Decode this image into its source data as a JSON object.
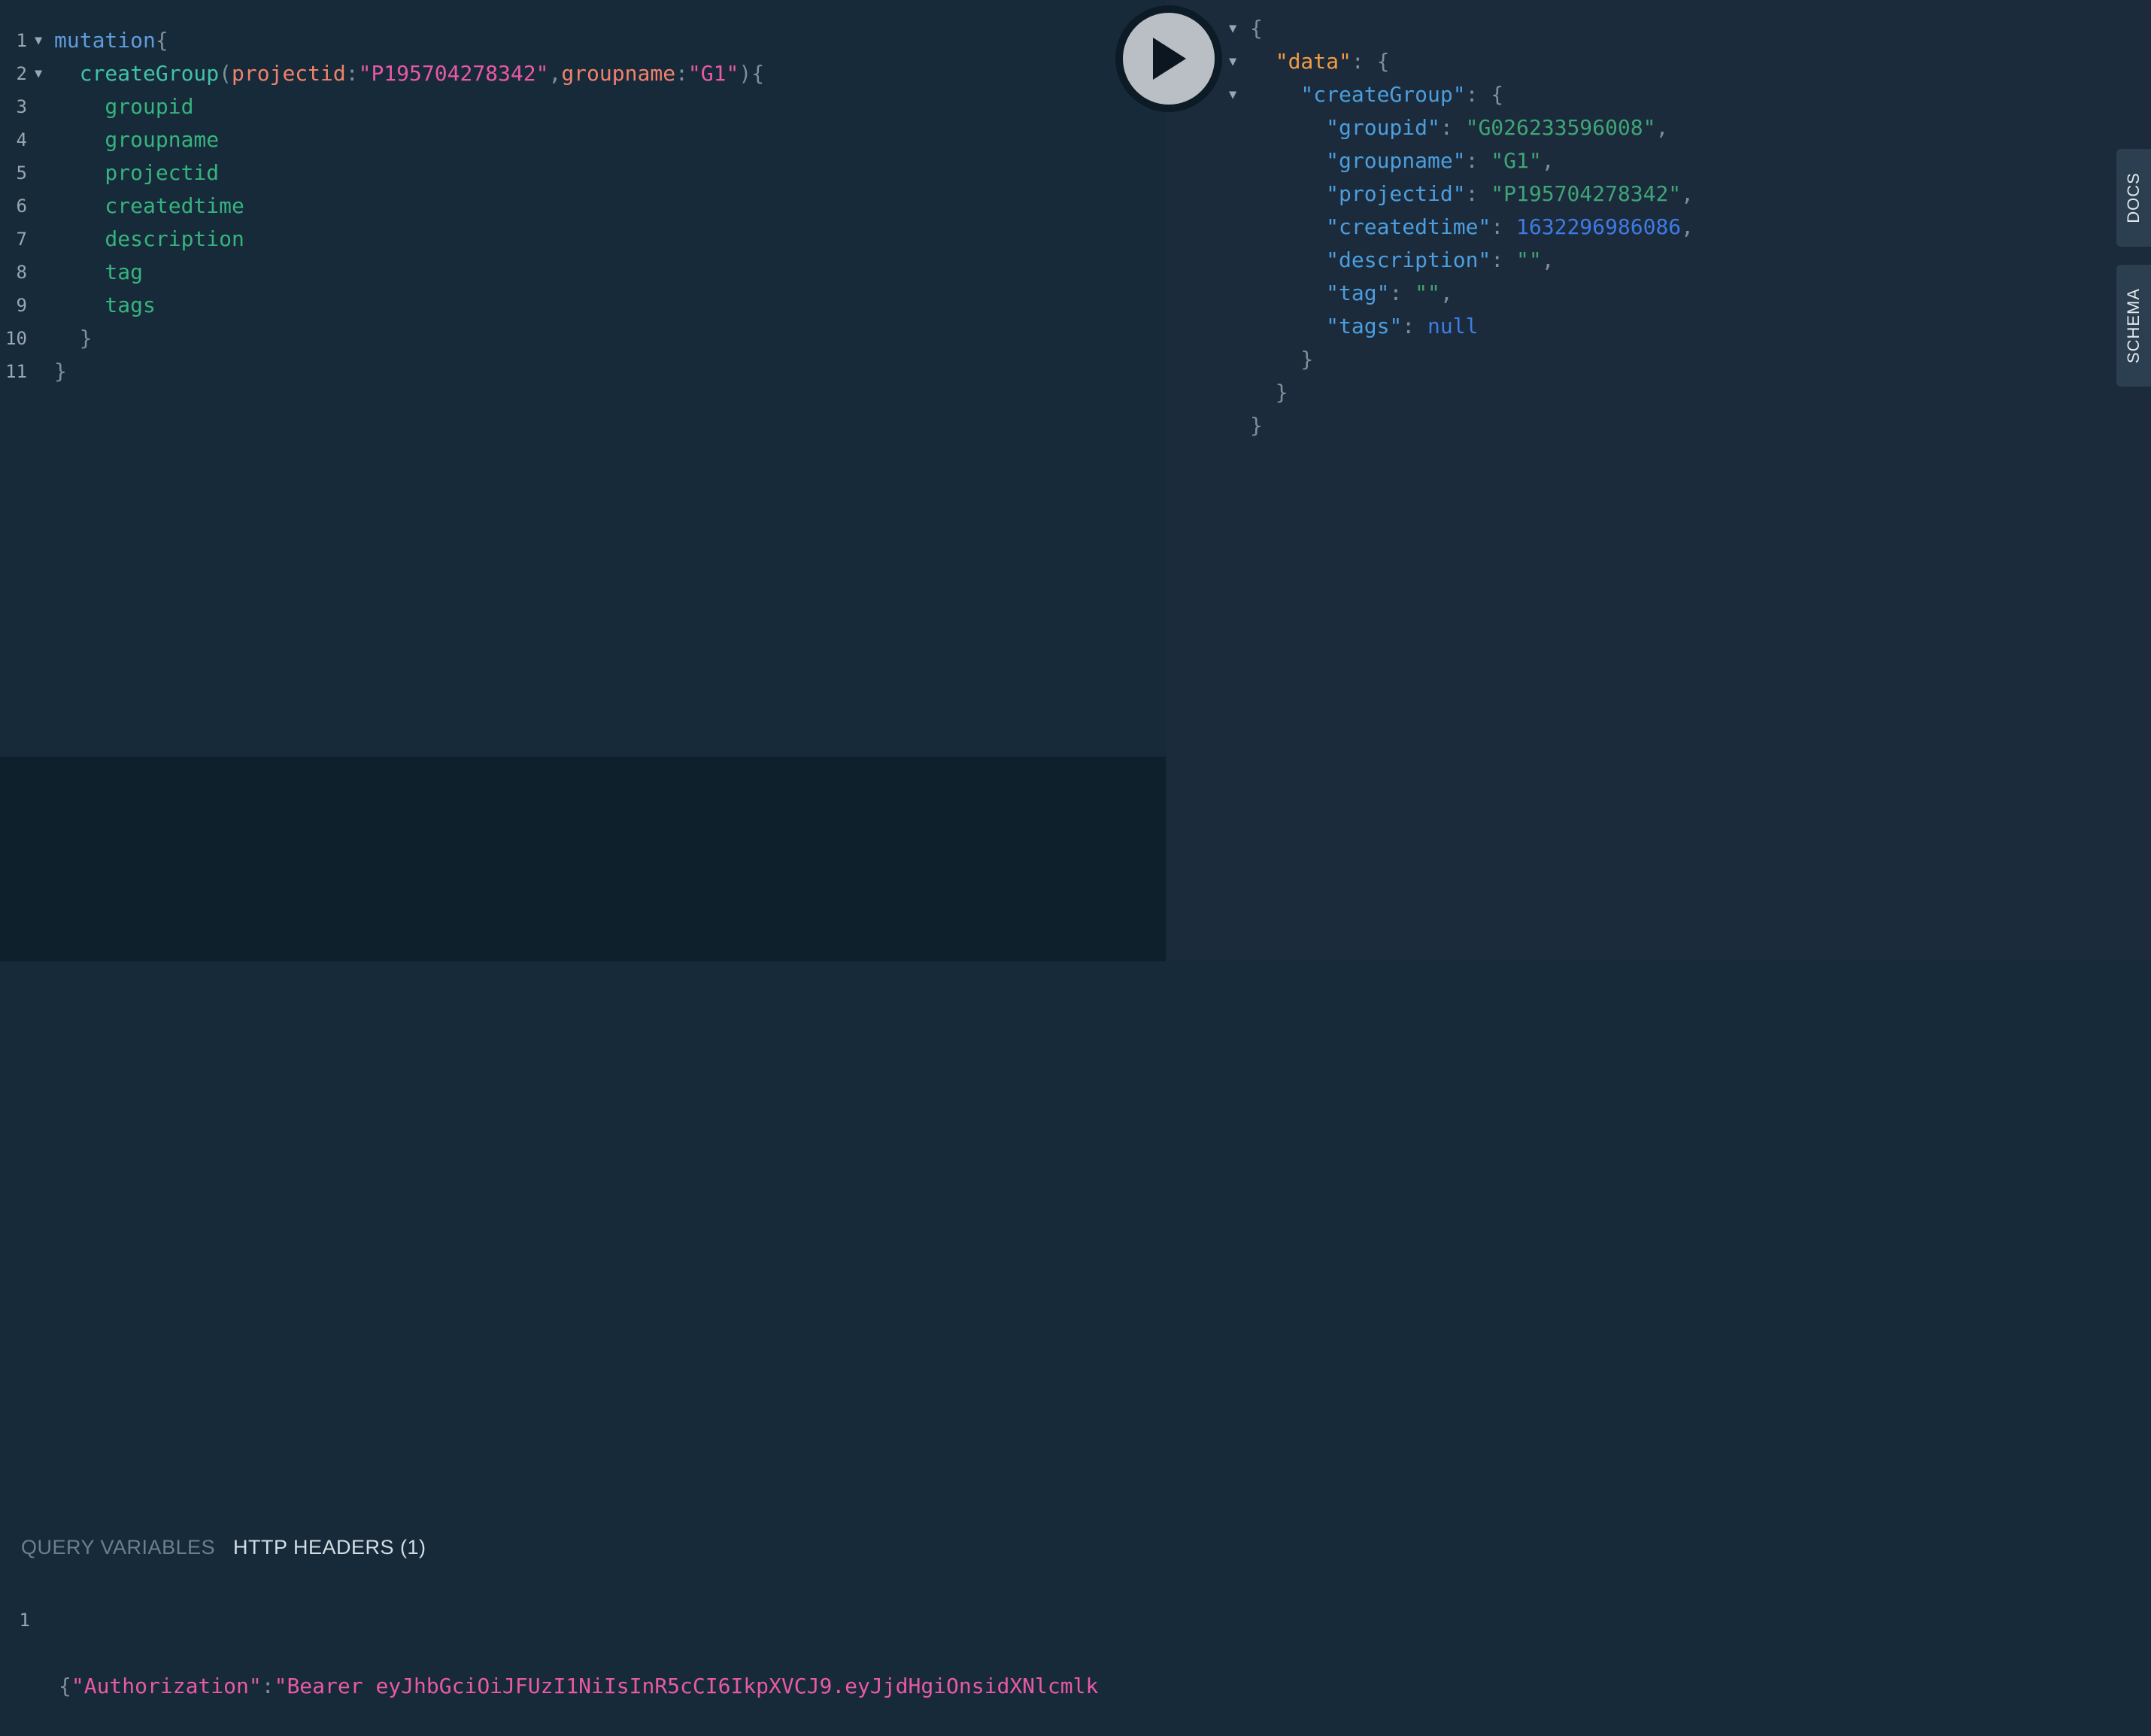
{
  "query_editor": {
    "lines": [
      {
        "num": "1",
        "tokens": [
          {
            "c": "kw",
            "t": "mutation"
          },
          {
            "c": "punct",
            "t": "{"
          }
        ]
      },
      {
        "num": "2",
        "tokens": [
          {
            "c": "fn",
            "t": "  createGroup"
          },
          {
            "c": "punct",
            "t": "("
          },
          {
            "c": "arg",
            "t": "projectid"
          },
          {
            "c": "punct",
            "t": ":"
          },
          {
            "c": "str",
            "t": "\"P195704278342\""
          },
          {
            "c": "punct",
            "t": ","
          },
          {
            "c": "arg",
            "t": "groupname"
          },
          {
            "c": "punct",
            "t": ":"
          },
          {
            "c": "str",
            "t": "\"G1\""
          },
          {
            "c": "punct",
            "t": "){"
          }
        ]
      },
      {
        "num": "3",
        "tokens": [
          {
            "c": "field",
            "t": "    groupid"
          }
        ]
      },
      {
        "num": "4",
        "tokens": [
          {
            "c": "field",
            "t": "    groupname"
          }
        ]
      },
      {
        "num": "5",
        "tokens": [
          {
            "c": "field",
            "t": "    projectid"
          }
        ]
      },
      {
        "num": "6",
        "tokens": [
          {
            "c": "field",
            "t": "    createdtime"
          }
        ]
      },
      {
        "num": "7",
        "tokens": [
          {
            "c": "field",
            "t": "    description"
          }
        ]
      },
      {
        "num": "8",
        "tokens": [
          {
            "c": "field",
            "t": "    tag"
          }
        ]
      },
      {
        "num": "9",
        "tokens": [
          {
            "c": "field",
            "t": "    tags"
          }
        ]
      },
      {
        "num": "10",
        "tokens": [
          {
            "c": "punct",
            "t": "  }"
          }
        ]
      },
      {
        "num": "11",
        "tokens": [
          {
            "c": "punct",
            "t": "}"
          }
        ]
      }
    ]
  },
  "bottom_panel": {
    "tab_query_variables": "QUERY VARIABLES",
    "tab_http_headers": "HTTP HEADERS (1)",
    "headers_line_num": "1",
    "headers_tokens": [
      {
        "c": "punct",
        "t": "{"
      },
      {
        "c": "str",
        "t": "\"Authorization\""
      },
      {
        "c": "punct",
        "t": ":"
      },
      {
        "c": "str",
        "t": "\"Bearer eyJhbGciOiJFUzI1NiIsInR5cCI6IkpXVCJ9.eyJjdHgiOnsidXNlcmlk"
      }
    ]
  },
  "result_viewer": {
    "lines": [
      {
        "tokens": [
          {
            "c": "punct",
            "t": "{"
          }
        ]
      },
      {
        "tokens": [
          {
            "c": "rkey-top",
            "t": "  \"data\""
          },
          {
            "c": "punct",
            "t": ": {"
          }
        ]
      },
      {
        "tokens": [
          {
            "c": "rkey",
            "t": "    \"createGroup\""
          },
          {
            "c": "punct",
            "t": ": {"
          }
        ]
      },
      {
        "tokens": [
          {
            "c": "rkey",
            "t": "      \"groupid\""
          },
          {
            "c": "punct",
            "t": ": "
          },
          {
            "c": "rstr",
            "t": "\"G026233596008\""
          },
          {
            "c": "punct",
            "t": ","
          }
        ]
      },
      {
        "tokens": [
          {
            "c": "rkey",
            "t": "      \"groupname\""
          },
          {
            "c": "punct",
            "t": ": "
          },
          {
            "c": "rstr",
            "t": "\"G1\""
          },
          {
            "c": "punct",
            "t": ","
          }
        ]
      },
      {
        "tokens": [
          {
            "c": "rkey",
            "t": "      \"projectid\""
          },
          {
            "c": "punct",
            "t": ": "
          },
          {
            "c": "rstr",
            "t": "\"P195704278342\""
          },
          {
            "c": "punct",
            "t": ","
          }
        ]
      },
      {
        "tokens": [
          {
            "c": "rkey",
            "t": "      \"createdtime\""
          },
          {
            "c": "punct",
            "t": ": "
          },
          {
            "c": "rnum",
            "t": "1632296986086"
          },
          {
            "c": "punct",
            "t": ","
          }
        ]
      },
      {
        "tokens": [
          {
            "c": "rkey",
            "t": "      \"description\""
          },
          {
            "c": "punct",
            "t": ": "
          },
          {
            "c": "rstr",
            "t": "\"\""
          },
          {
            "c": "punct",
            "t": ","
          }
        ]
      },
      {
        "tokens": [
          {
            "c": "rkey",
            "t": "      \"tag\""
          },
          {
            "c": "punct",
            "t": ": "
          },
          {
            "c": "rstr",
            "t": "\"\""
          },
          {
            "c": "punct",
            "t": ","
          }
        ]
      },
      {
        "tokens": [
          {
            "c": "rkey",
            "t": "      \"tags\""
          },
          {
            "c": "punct",
            "t": ": "
          },
          {
            "c": "rnull",
            "t": "null"
          }
        ]
      },
      {
        "tokens": [
          {
            "c": "punct",
            "t": "    }"
          }
        ]
      },
      {
        "tokens": [
          {
            "c": "punct",
            "t": "  }"
          }
        ]
      },
      {
        "tokens": [
          {
            "c": "punct",
            "t": "}"
          }
        ]
      }
    ]
  },
  "side_tabs": {
    "docs": "DOCS",
    "schema": "SCHEMA"
  },
  "icons": {
    "run": "play-icon",
    "fold": "fold-arrow-icon"
  },
  "colors": {
    "editor_bg": "#172a3a",
    "result_bg": "#1b2b3b",
    "vars_bg": "#0f202d"
  }
}
